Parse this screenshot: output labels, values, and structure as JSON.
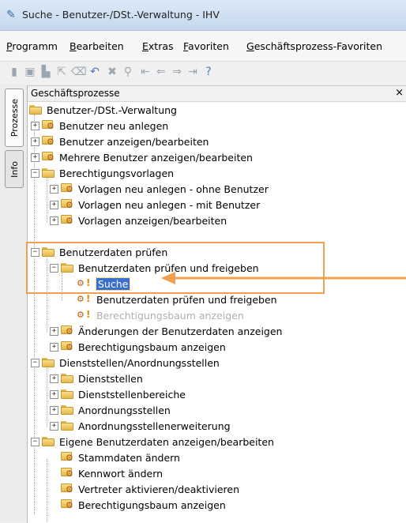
{
  "window": {
    "title": "Suche - Benutzer-/DSt.-Verwaltung - IHV"
  },
  "menu": [
    "Programm",
    "Bearbeiten",
    "Extras",
    "Favoriten",
    "Geschäftsprozess-Favoriten"
  ],
  "toolbar_icons": [
    "new-icon",
    "save-icon",
    "print-icon",
    "export-icon",
    "clear-icon",
    "undo-icon",
    "delete-icon",
    "search-icon",
    "first-icon",
    "back-icon",
    "forward-icon",
    "last-icon",
    "help-icon"
  ],
  "side_tabs": [
    "Prozesse",
    "Info"
  ],
  "panel": {
    "title": "Geschäftsprozesse",
    "close": "×"
  },
  "tree": [
    "Benutzer-/DSt.-Verwaltung",
    "Benutzer neu anlegen",
    "Benutzer anzeigen/bearbeiten",
    "Mehrere Benutzer anzeigen/bearbeiten",
    "Berechtigungsvorlagen",
    "Vorlagen neu anlegen - ohne Benutzer",
    "Vorlagen neu anlegen - mit Benutzer",
    "Vorlagen anzeigen/bearbeiten",
    "Benutzerdaten prüfen",
    "Benutzerdaten prüfen und freigeben",
    "Suche",
    "Benutzerdaten prüfen und freigeben",
    "Berechtigungsbaum anzeigen",
    "Änderungen der Benutzerdaten anzeigen",
    "Berechtigungsbaum anzeigen",
    "Dienststellen/Anordnungsstellen",
    "Dienststellen",
    "Dienststellenbereiche",
    "Anordnungsstellen",
    "Anordnungsstellenerweiterung",
    "Eigene Benutzerdaten anzeigen/bearbeiten",
    "Stammdaten ändern",
    "Kennwort ändern",
    "Vertreter aktivieren/deaktivieren",
    "Berechtigungsbaum anzeigen"
  ],
  "colors": {
    "highlight": "#f0a050",
    "selection": "#3a6fd0"
  }
}
